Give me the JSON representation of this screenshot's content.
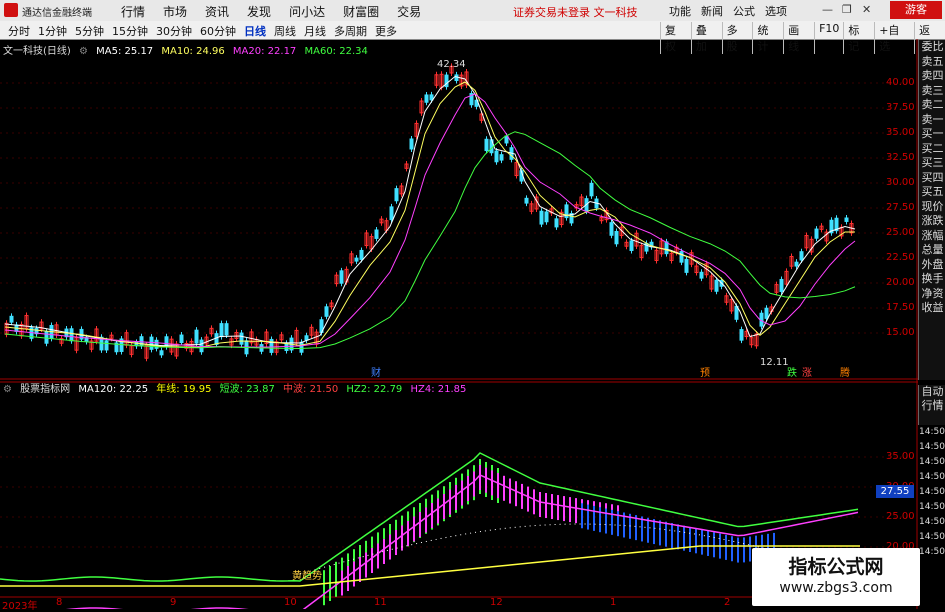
{
  "titlebar": {
    "app_name": "通达信金融终端",
    "menu": [
      "行情",
      "市场",
      "资讯",
      "发现",
      "问小达",
      "财富圈",
      "交易"
    ],
    "notice": "证券交易未登录  文一科技",
    "right_menu": [
      "功能",
      "新闻",
      "公式",
      "选项"
    ],
    "guest_label": "游客"
  },
  "periodbar": {
    "periods": [
      "分时",
      "1分钟",
      "5分钟",
      "15分钟",
      "30分钟",
      "60分钟",
      "日线",
      "周线",
      "月线",
      "多周期",
      "更多"
    ],
    "active_period": "日线",
    "tools": [
      "复权",
      "叠加",
      "多股",
      "统计",
      "画线",
      "F10",
      "标记",
      "+自选",
      "返回"
    ]
  },
  "main_chart": {
    "stock_label": "文一科技(日线)",
    "ma": [
      {
        "label": "MA5: 25.17",
        "color": "#ffffff"
      },
      {
        "label": "MA10: 24.96",
        "color": "#ffff60"
      },
      {
        "label": "MA20: 22.17",
        "color": "#ff40ff"
      },
      {
        "label": "MA60: 22.34",
        "color": "#40ff40"
      }
    ],
    "price_labels": [
      "40.00",
      "37.50",
      "35.00",
      "32.50",
      "30.00",
      "27.50",
      "25.00",
      "22.50",
      "20.00",
      "17.50",
      "15.00"
    ],
    "high_label": "42.34",
    "low_label": "12.11",
    "event_tags": [
      {
        "text": "财",
        "color": "#4080ff"
      },
      {
        "text": "预",
        "color": "#ff8000"
      },
      {
        "text": "跌",
        "color": "#40ff40"
      },
      {
        "text": "涨",
        "color": "#ff4040"
      },
      {
        "text": "腾",
        "color": "#ff8000"
      }
    ]
  },
  "sidebar_quote": [
    "委比",
    "卖五",
    "卖四",
    "卖三",
    "卖二",
    "卖一",
    "买一",
    "买二",
    "买三",
    "买四",
    "买五",
    "现价",
    "涨跌",
    "涨幅",
    "总量",
    "外盘",
    "换手",
    "净资",
    "收益"
  ],
  "sidebar_lower": [
    "自动",
    "行情"
  ],
  "sidebar_times": [
    "14:50",
    "14:50",
    "14:50",
    "14:50",
    "14:50",
    "14:50",
    "14:50",
    "14:50",
    "14:50"
  ],
  "indicator": {
    "name": "股票指标网",
    "values": [
      {
        "label": "MA120: 22.25",
        "color": "#ffffff"
      },
      {
        "label": "年线: 19.95",
        "color": "#ffff00"
      },
      {
        "label": "短波: 23.87",
        "color": "#40ff40"
      },
      {
        "label": "中波: 21.50",
        "color": "#ff4040"
      },
      {
        "label": "HZ2: 22.79",
        "color": "#40ff40"
      },
      {
        "label": "HZ4: 21.85",
        "color": "#ff40ff"
      }
    ],
    "y_labels": [
      "35.00",
      "30.00",
      "25.00",
      "20.00"
    ],
    "current_value": "27.55",
    "annotation": "黄趋势"
  },
  "date_axis": [
    "2023年",
    "8",
    "9",
    "10",
    "11",
    "12",
    "1",
    "2"
  ],
  "watermark": {
    "line1": "指标公式网",
    "line2": "www.zbgs3.com"
  }
}
